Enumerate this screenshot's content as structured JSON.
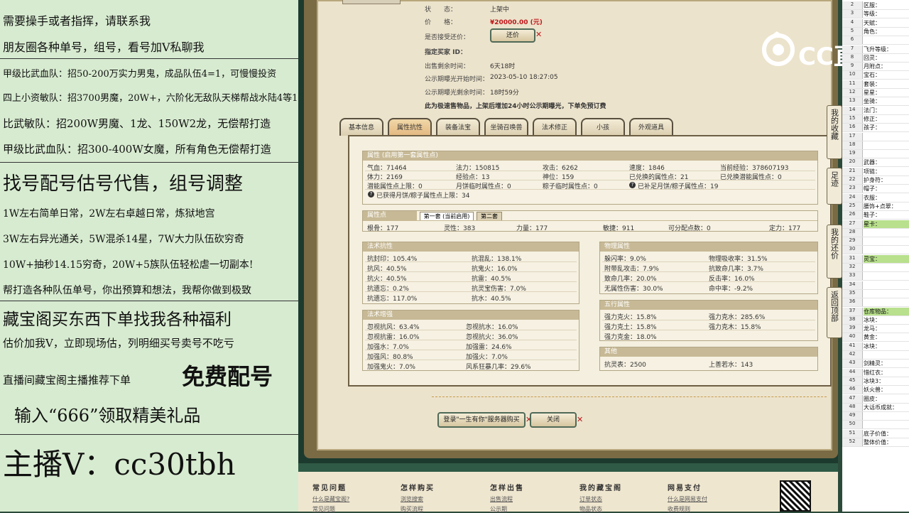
{
  "promo": {
    "l1": "需要操手或者指挥，请联系我",
    "l2": "朋友圈各种单号，组号，看号加V私聊我",
    "l3": "甲级比武血队：招50-200万实力男鬼，成品队伍4=1，可慢慢投资",
    "l4": "四上小资敏队：招3700男魔，20W+，六阶化无敌队天梯帮战水陆4等1",
    "l5": "比武敏队：招200W男魔、1龙、150W2龙，无偿帮打造",
    "l6": "甲级比武血队：招300-400W女魔，所有角色无偿帮打造",
    "l7": "找号配号估号代售，组号调整",
    "l8": "1W左右简单日常，2W左右卓越日常，炼狱地宫",
    "l9": "3W左右异光通关，5W混杀14星，7W大力队伍砍穷奇",
    "l10": "10W+抽秒14.15穷奇，20W+5族队伍轻松虐一切副本!",
    "l11": "帮打造各种队伍单号，你出预算和想法，我帮你做到极致",
    "l12": "藏宝阁买东西下单找我各种福利",
    "l13": "估价加我V，立即现场估，列明细买号卖号不吃亏",
    "l14a": "直播间藏宝阁主播推荐下单",
    "l14b": "免费配号",
    "l15": "输入“666”领取精美礼品",
    "l16": "主播V：cc30tbh"
  },
  "listing": {
    "status_label": "状　　态：",
    "status_value": "上架中",
    "price_label": "价　　格：",
    "price_value": "¥20000.00 (元)",
    "bargain_label": "是否接受还价：",
    "bargain_button": "还价",
    "buyer_id_label": "指定买家 ID：",
    "remaining_label": "出售剩余时间：",
    "remaining_value": "6天18时",
    "public_start_label": "公示期曝光开始时间：",
    "public_start_value": "2023-05-10 18:27:05",
    "public_remain_label": "公示期曝光剩余时间：",
    "public_remain_value": "18时59分",
    "notice": "此为极速售物品，上架后增加24小时公示期曝光，下单免预订费"
  },
  "tabs": [
    "基本信息",
    "属性抗性",
    "装备法宝",
    "坐骑召唤兽",
    "法术修正",
    "小孩",
    "外观道具"
  ],
  "attr": {
    "header": "属性 (启用第一套属性点)",
    "r1": [
      "气血：71464",
      "法力：150815",
      "攻击：6262",
      "速度：1846",
      "当前经验：378607193"
    ],
    "r2": [
      "体力：2169",
      "经验点：13",
      "神位：159",
      "已兑换的属性点：21",
      "已兑换潜能属性点：0"
    ],
    "r3": [
      "潜能属性点上限：0",
      "月饼临时属性点：0",
      "粽子临时属性点：0",
      "已补足月饼/粽子属性点：19"
    ],
    "r4": "已获得月饼/粽子属性点上限：34"
  },
  "points": {
    "header": "属性点",
    "tab1": "第一套 (当前启用)",
    "tab2": "第二套",
    "values": [
      "根骨：177",
      "灵性：383",
      "力量：177",
      "敏捷：911",
      "可分配点数：0",
      "定力：177"
    ]
  },
  "resist": {
    "header": "法术抗性",
    "left": [
      "抗封印：105.4%",
      "抗风：40.5%",
      "抗火：40.5%",
      "抗遗忘：0.2%",
      "抗遗忘：117.0%"
    ],
    "right": [
      "抗混乱：138.1%",
      "抗鬼火：16.0%",
      "抗雷：40.5%",
      "抗灵宝伤害：7.0%",
      "抗水：40.5%"
    ]
  },
  "boost": {
    "header": "法术增强",
    "left": [
      "忽视抗风：63.4%",
      "忽视抗雷：16.0%",
      "加强水：7.0%",
      "加强风：80.8%",
      "加强鬼火：7.0%"
    ],
    "right": [
      "忽视抗水：16.0%",
      "忽视抗火：36.0%",
      "加强雷：24.6%",
      "加强火：7.0%",
      "风系狂暴几率：29.6%"
    ]
  },
  "physical": {
    "header": "物理属性",
    "left": [
      "躲闪率：9.0%",
      "附带乱攻击：7.9%",
      "致命几率：20.0%",
      "无属性伤害：30.0%"
    ],
    "right": [
      "物理吸收率：31.5%",
      "抗致命几率：3.7%",
      "反击率：16.0%",
      "命中率：-9.2%"
    ]
  },
  "five": {
    "header": "五行属性",
    "left": [
      "强力克火：15.8%",
      "强力克土：15.8%",
      "强力克金：18.0%"
    ],
    "right": [
      "强力克水：285.6%",
      "强力克木：15.8%"
    ]
  },
  "other": {
    "header": "其他",
    "left": "抗灵表：2500",
    "right": "上善若水：143"
  },
  "actions": {
    "login": "登录\"一生有你\"服务器购买",
    "close": "关闭"
  },
  "footer": {
    "h1": "常见问题",
    "h2": "怎样购买",
    "h3": "怎样出售",
    "h4": "我的藏宝阁",
    "h5": "网易支付",
    "a1": "什么是藏宝阁?",
    "a2": "常见问题",
    "b1": "浏览搜索",
    "b2": "购买流程",
    "c1": "出售流程",
    "c2": "公示期",
    "d1": "订单状态",
    "d2": "物品状态",
    "e1": "什么是网易支付",
    "e2": "收费规则"
  },
  "side_tabs": [
    "我的收藏",
    "足迹",
    "我的还价",
    "返回顶部"
  ],
  "logo": "CC直播",
  "sheet": {
    "rows": [
      {
        "n": "2",
        "v": "区服："
      },
      {
        "n": "3",
        "v": "等级："
      },
      {
        "n": "4",
        "v": "天赋："
      },
      {
        "n": "5",
        "v": "角色："
      },
      {
        "n": "6",
        "v": ""
      },
      {
        "n": "7",
        "v": "飞升等级："
      },
      {
        "n": "8",
        "v": "回灵："
      },
      {
        "n": "9",
        "v": "月附点："
      },
      {
        "n": "10",
        "v": "宝石："
      },
      {
        "n": "11",
        "v": "套装："
      },
      {
        "n": "12",
        "v": "星星："
      },
      {
        "n": "13",
        "v": "坐骑："
      },
      {
        "n": "14",
        "v": "法门："
      },
      {
        "n": "15",
        "v": "修正："
      },
      {
        "n": "16",
        "v": "孩子："
      },
      {
        "n": "17",
        "v": ""
      },
      {
        "n": "18",
        "v": ""
      },
      {
        "n": "19",
        "v": ""
      },
      {
        "n": "20",
        "v": "武器："
      },
      {
        "n": "21",
        "v": "项链："
      },
      {
        "n": "22",
        "v": "护身符："
      },
      {
        "n": "23",
        "v": "帽子："
      },
      {
        "n": "24",
        "v": "衣服："
      },
      {
        "n": "25",
        "v": "腰饰+点翠："
      },
      {
        "n": "26",
        "v": "鞋子："
      },
      {
        "n": "27",
        "v": "星卡："
      },
      {
        "n": "28",
        "v": ""
      },
      {
        "n": "29",
        "v": ""
      },
      {
        "n": "30",
        "v": ""
      },
      {
        "n": "31",
        "v": "灵宝："
      },
      {
        "n": "32",
        "v": ""
      },
      {
        "n": "33",
        "v": ""
      },
      {
        "n": "34",
        "v": ""
      },
      {
        "n": "35",
        "v": ""
      },
      {
        "n": "36",
        "v": ""
      },
      {
        "n": "37",
        "v": "仓库物品："
      },
      {
        "n": "38",
        "v": "冰块："
      },
      {
        "n": "39",
        "v": "龙马："
      },
      {
        "n": "40",
        "v": "黄金："
      },
      {
        "n": "41",
        "v": "冰块："
      },
      {
        "n": "42",
        "v": ""
      },
      {
        "n": "43",
        "v": "剑精灵："
      },
      {
        "n": "44",
        "v": "惜红衣："
      },
      {
        "n": "45",
        "v": "冰块3："
      },
      {
        "n": "46",
        "v": "妖火兽："
      },
      {
        "n": "47",
        "v": "圈皮："
      },
      {
        "n": "48",
        "v": "大话币成就："
      },
      {
        "n": "49",
        "v": ""
      },
      {
        "n": "50",
        "v": ""
      },
      {
        "n": "51",
        "v": "底子价值："
      },
      {
        "n": "52",
        "v": "整体价值："
      }
    ]
  },
  "colors": {
    "accent_red": "#c0171b",
    "promo_bg": "#d7ebd0",
    "sheet_highlight": "#b8e08d"
  }
}
